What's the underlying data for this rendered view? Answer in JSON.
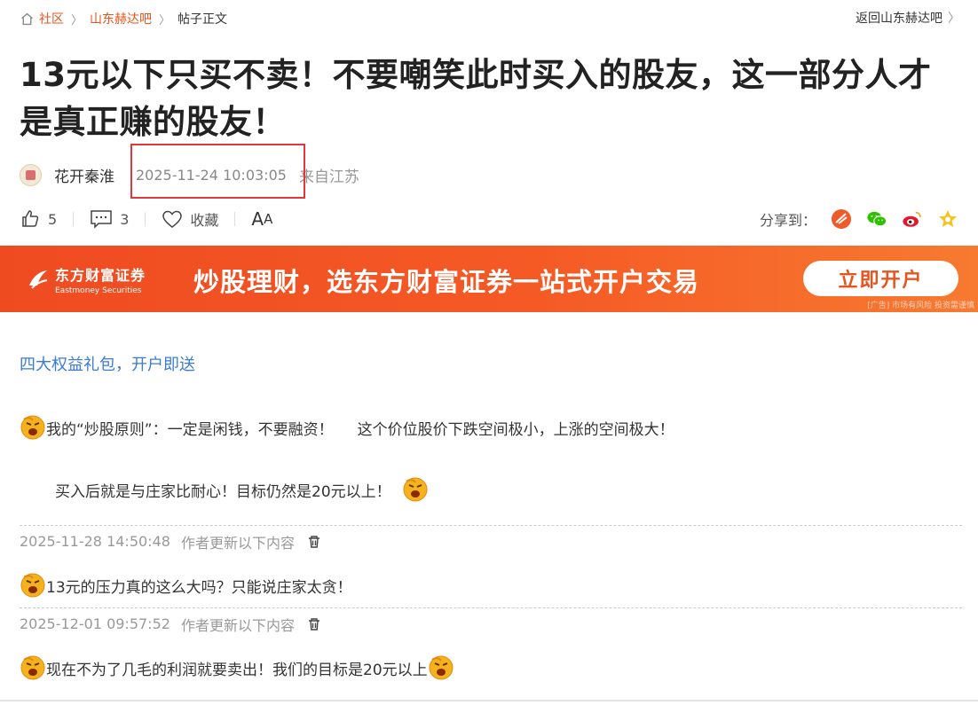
{
  "breadcrumb": {
    "items": [
      "社区",
      "山东赫达吧"
    ],
    "current": "帖子正文",
    "back": "返回山东赫达吧"
  },
  "post": {
    "title": "13元以下只买不卖！不要嘲笑此时买入的股友，这一部分人才是真正赚的股友！",
    "author": "花开秦淮",
    "time": "2025-11-24 10:03:05",
    "location": "来自江苏"
  },
  "actions": {
    "likes": "5",
    "comments": "3",
    "favorite_label": "收藏",
    "font_big": "A",
    "font_small": "A",
    "share_label": "分享到："
  },
  "banner": {
    "logo_cn": "东方财富证券",
    "logo_en": "Eastmoney Securities",
    "slogan": "炒股理财，选东方财富证券一站式开户交易",
    "button": "立即开户",
    "note": "[广告] 市场有风险 投资需谨慎"
  },
  "content": {
    "promo_link": "四大权益礼包，开户即送",
    "line1": "我的“炒股原则”：一定是闲钱，不要融资！     这个价位股价下跌空间极小，上涨的空间极大！",
    "line2": "买入后就是与庄家比耐心！目标仍然是20元以上！",
    "updates": [
      {
        "time": "2025-11-28 14:50:48",
        "label": "作者更新以下内容",
        "text": "13元的压力真的这么大吗？只能说庄家太贪！"
      },
      {
        "time": "2025-12-01 09:57:52",
        "label": "作者更新以下内容",
        "text": "现在不为了几毛的利润就要卖出！我们的目标是20元以上"
      }
    ]
  },
  "colors": {
    "accent": "#e8541e",
    "link": "#3a7bd5",
    "highlight_box": "#e0373d"
  }
}
